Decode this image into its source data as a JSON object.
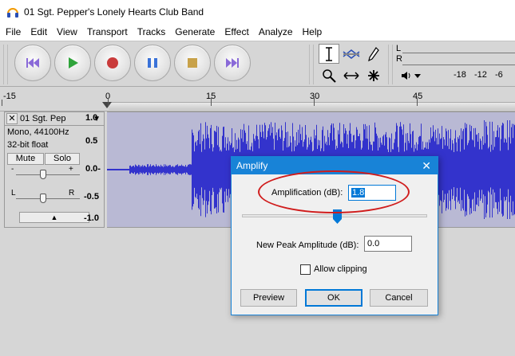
{
  "window": {
    "title": "01 Sgt. Pepper's Lonely Hearts Club Band",
    "app_icon": "headphones-icon"
  },
  "menu": [
    "File",
    "Edit",
    "View",
    "Transport",
    "Tracks",
    "Generate",
    "Effect",
    "Analyze",
    "Help"
  ],
  "transport": {
    "buttons": [
      "skip-to-start",
      "play",
      "record",
      "pause",
      "stop",
      "skip-to-end"
    ],
    "colors": {
      "skip": "#8a6ad8",
      "play": "#2fa33a",
      "record": "#c93b3b",
      "pause": "#3a72d8",
      "stop": "#c8a24a"
    }
  },
  "tools": [
    "selection-tool",
    "envelope-tool",
    "draw-tool",
    "zoom-tool",
    "time-shift-tool",
    "multi-tool"
  ],
  "meter": {
    "channels": [
      "L",
      "R"
    ],
    "scale": [
      "-18",
      "-12",
      "-6"
    ]
  },
  "ruler": {
    "labels": [
      "-15",
      "0",
      "15",
      "30",
      "45"
    ]
  },
  "track": {
    "name": "01 Sgt. Pep",
    "info_line1": "Mono, 44100Hz",
    "info_line2": "32-bit float",
    "mute_label": "Mute",
    "solo_label": "Solo",
    "gain_minus": "-",
    "gain_plus": "+",
    "pan_left": "L",
    "pan_right": "R",
    "scale": [
      "1.0",
      "0.5",
      "0.0-",
      "-0.5",
      "-1.0"
    ],
    "wave_color": "#3333cc"
  },
  "dialog": {
    "title": "Amplify",
    "amplification_label": "Amplification (dB):",
    "amplification_value": "1.8",
    "new_peak_label": "New Peak Amplitude (dB):",
    "new_peak_value": "0.0",
    "allow_clipping_label": "Allow clipping",
    "allow_clipping_checked": false,
    "preview_label": "Preview",
    "ok_label": "OK",
    "cancel_label": "Cancel",
    "accent": "#1883d7"
  }
}
